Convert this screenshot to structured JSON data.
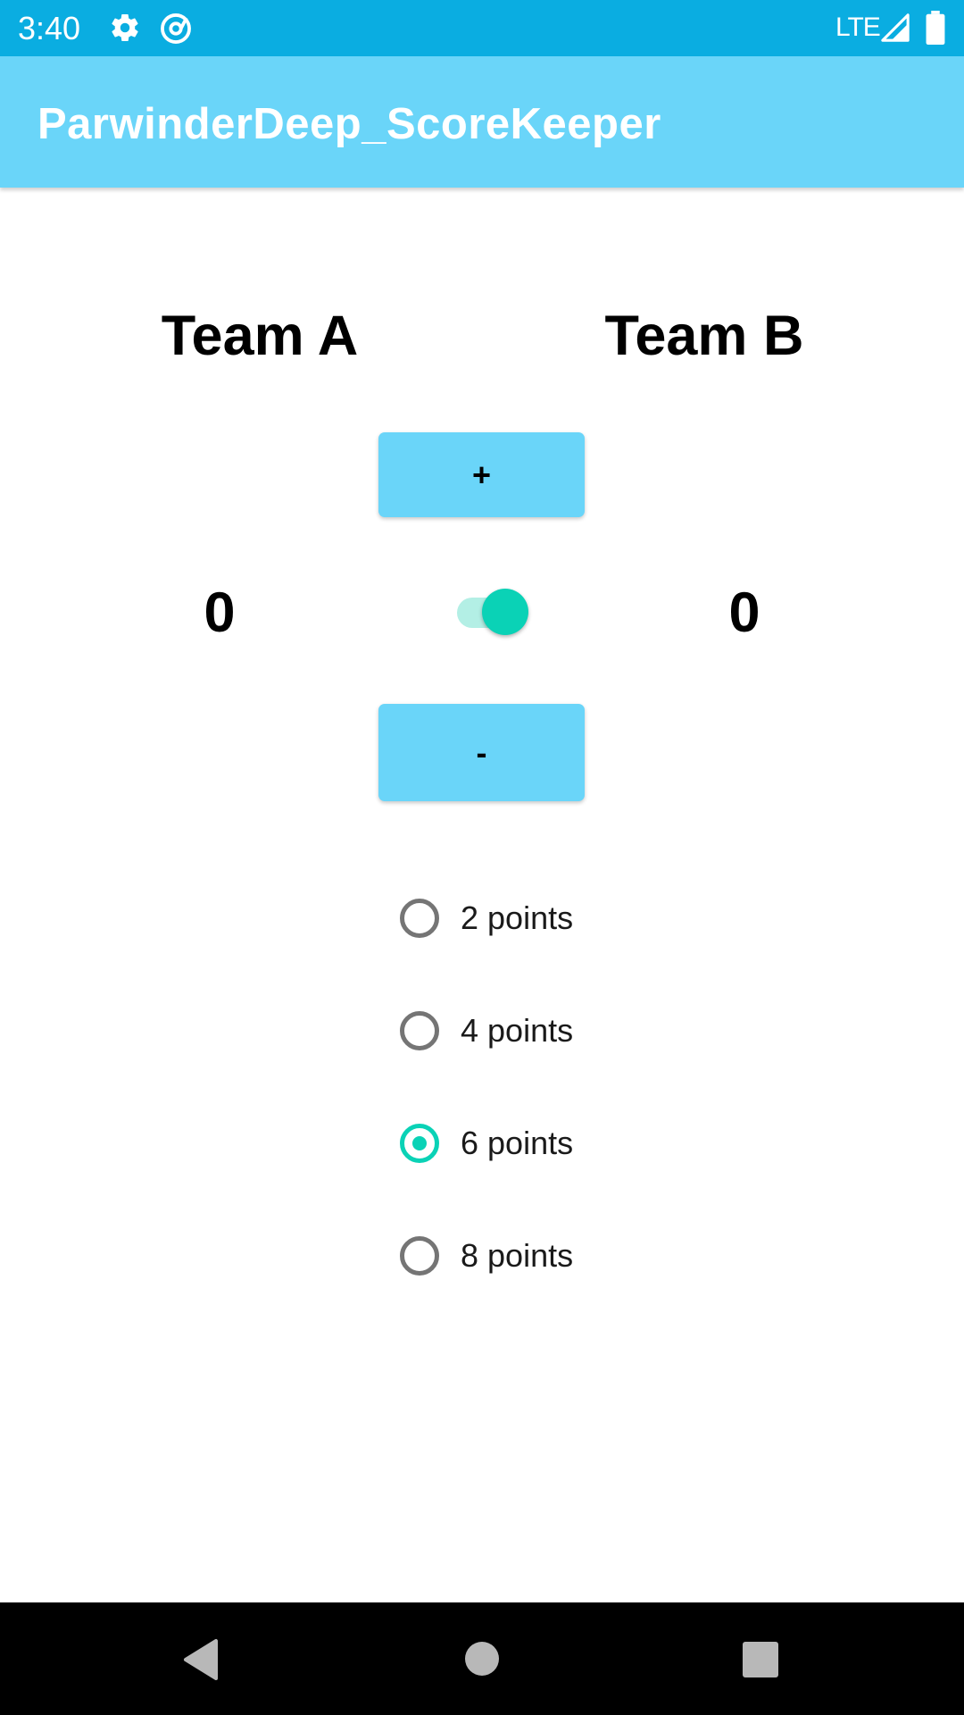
{
  "status_bar": {
    "time": "3:40",
    "network": "LTE",
    "icons": [
      "gear-icon",
      "at-sign-icon",
      "signal-icon",
      "battery-icon"
    ]
  },
  "app_bar": {
    "title": "ParwinderDeep_ScoreKeeper",
    "color": "#6ad5f9"
  },
  "teams": {
    "team_a": {
      "label": "Team A",
      "score": "0"
    },
    "team_b": {
      "label": "Team B",
      "score": "0"
    }
  },
  "controls": {
    "plus_label": "+",
    "minus_label": "-",
    "team_switch_on": true
  },
  "points_options": [
    {
      "label": "2 points",
      "checked": false
    },
    {
      "label": "4 points",
      "checked": false
    },
    {
      "label": "6 points",
      "checked": true
    },
    {
      "label": "8 points",
      "checked": false
    }
  ],
  "nav_bar": {
    "buttons": [
      "back-icon",
      "home-icon",
      "recents-icon"
    ]
  },
  "colors": {
    "status_bar": "#0aade1",
    "accent": "#0ad2b6",
    "button": "#6ad5f9"
  }
}
